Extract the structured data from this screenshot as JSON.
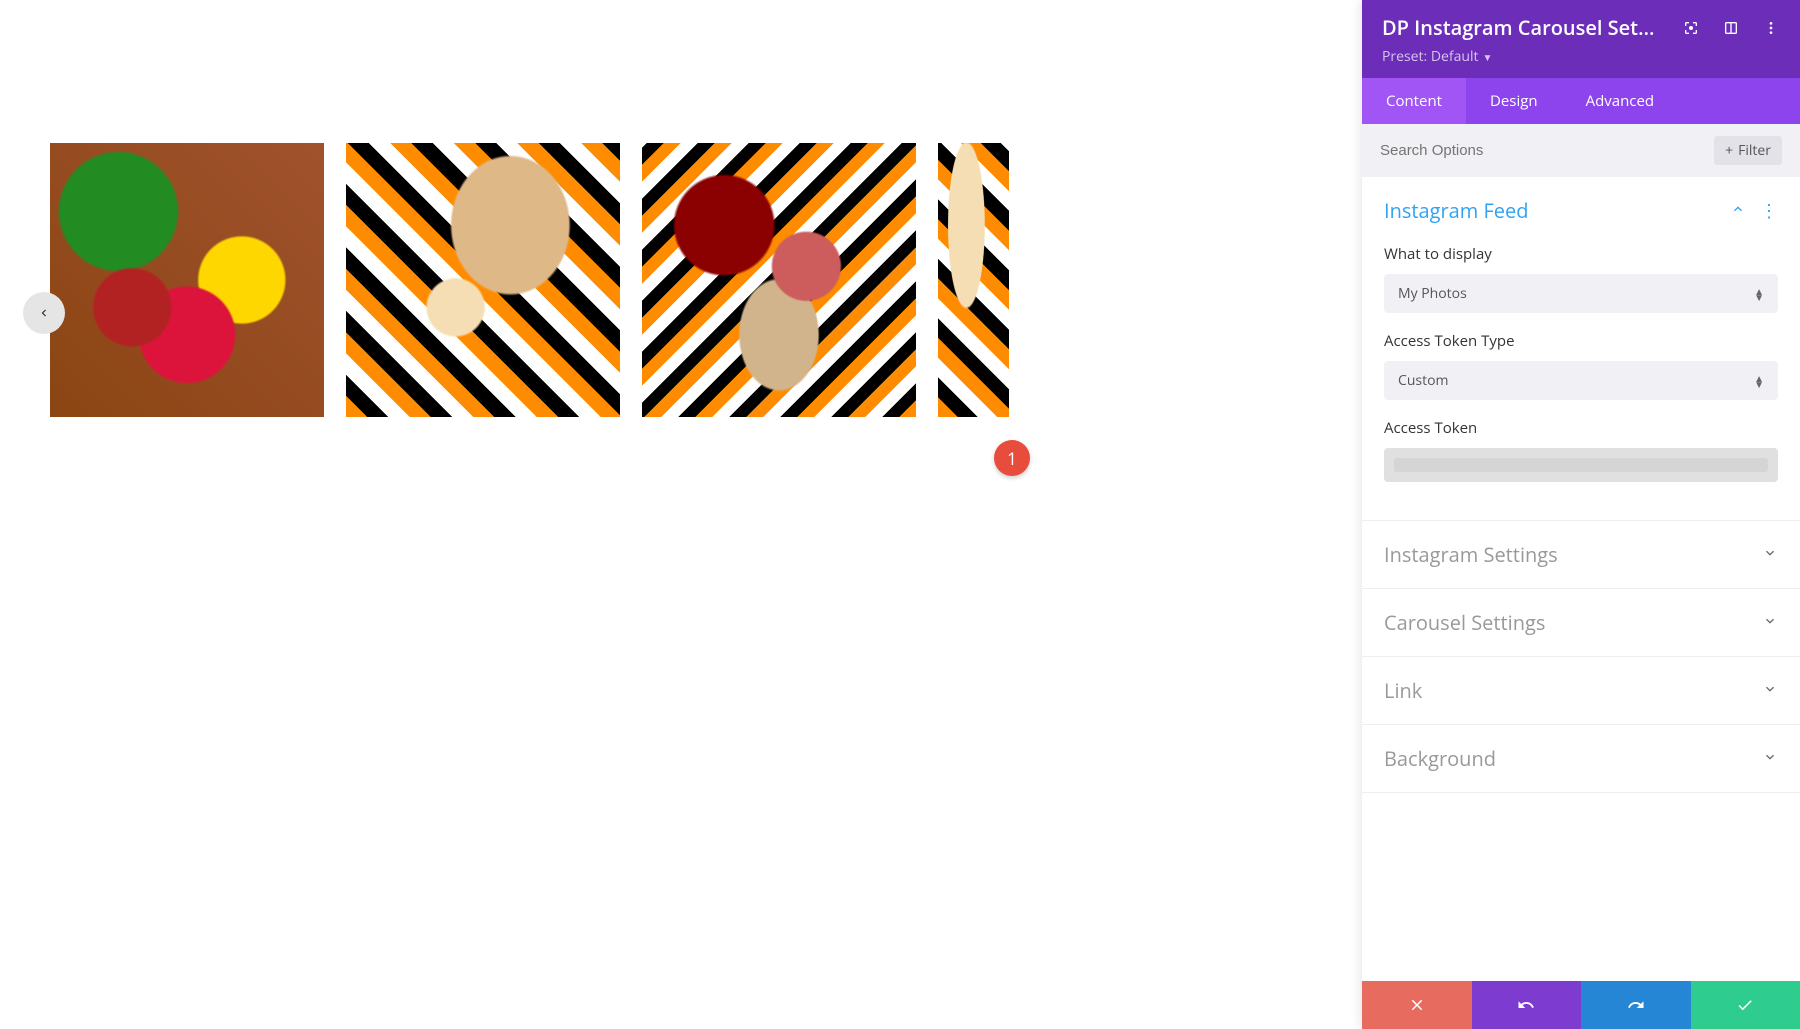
{
  "panel": {
    "title": "DP Instagram Carousel Sett...",
    "preset_label": "Preset: Default"
  },
  "tabs": {
    "content": "Content",
    "design": "Design",
    "advanced": "Advanced"
  },
  "search": {
    "placeholder": "Search Options",
    "filter_label": "Filter"
  },
  "sections": {
    "instagram_feed": {
      "title": "Instagram Feed",
      "what_to_display_label": "What to display",
      "what_to_display_value": "My Photos",
      "access_token_type_label": "Access Token Type",
      "access_token_type_value": "Custom",
      "access_token_label": "Access Token",
      "access_token_value": ""
    },
    "instagram_settings": {
      "title": "Instagram Settings"
    },
    "carousel_settings": {
      "title": "Carousel Settings"
    },
    "link": {
      "title": "Link"
    },
    "background": {
      "title": "Background"
    }
  },
  "annotation": {
    "badge_1": "1"
  }
}
